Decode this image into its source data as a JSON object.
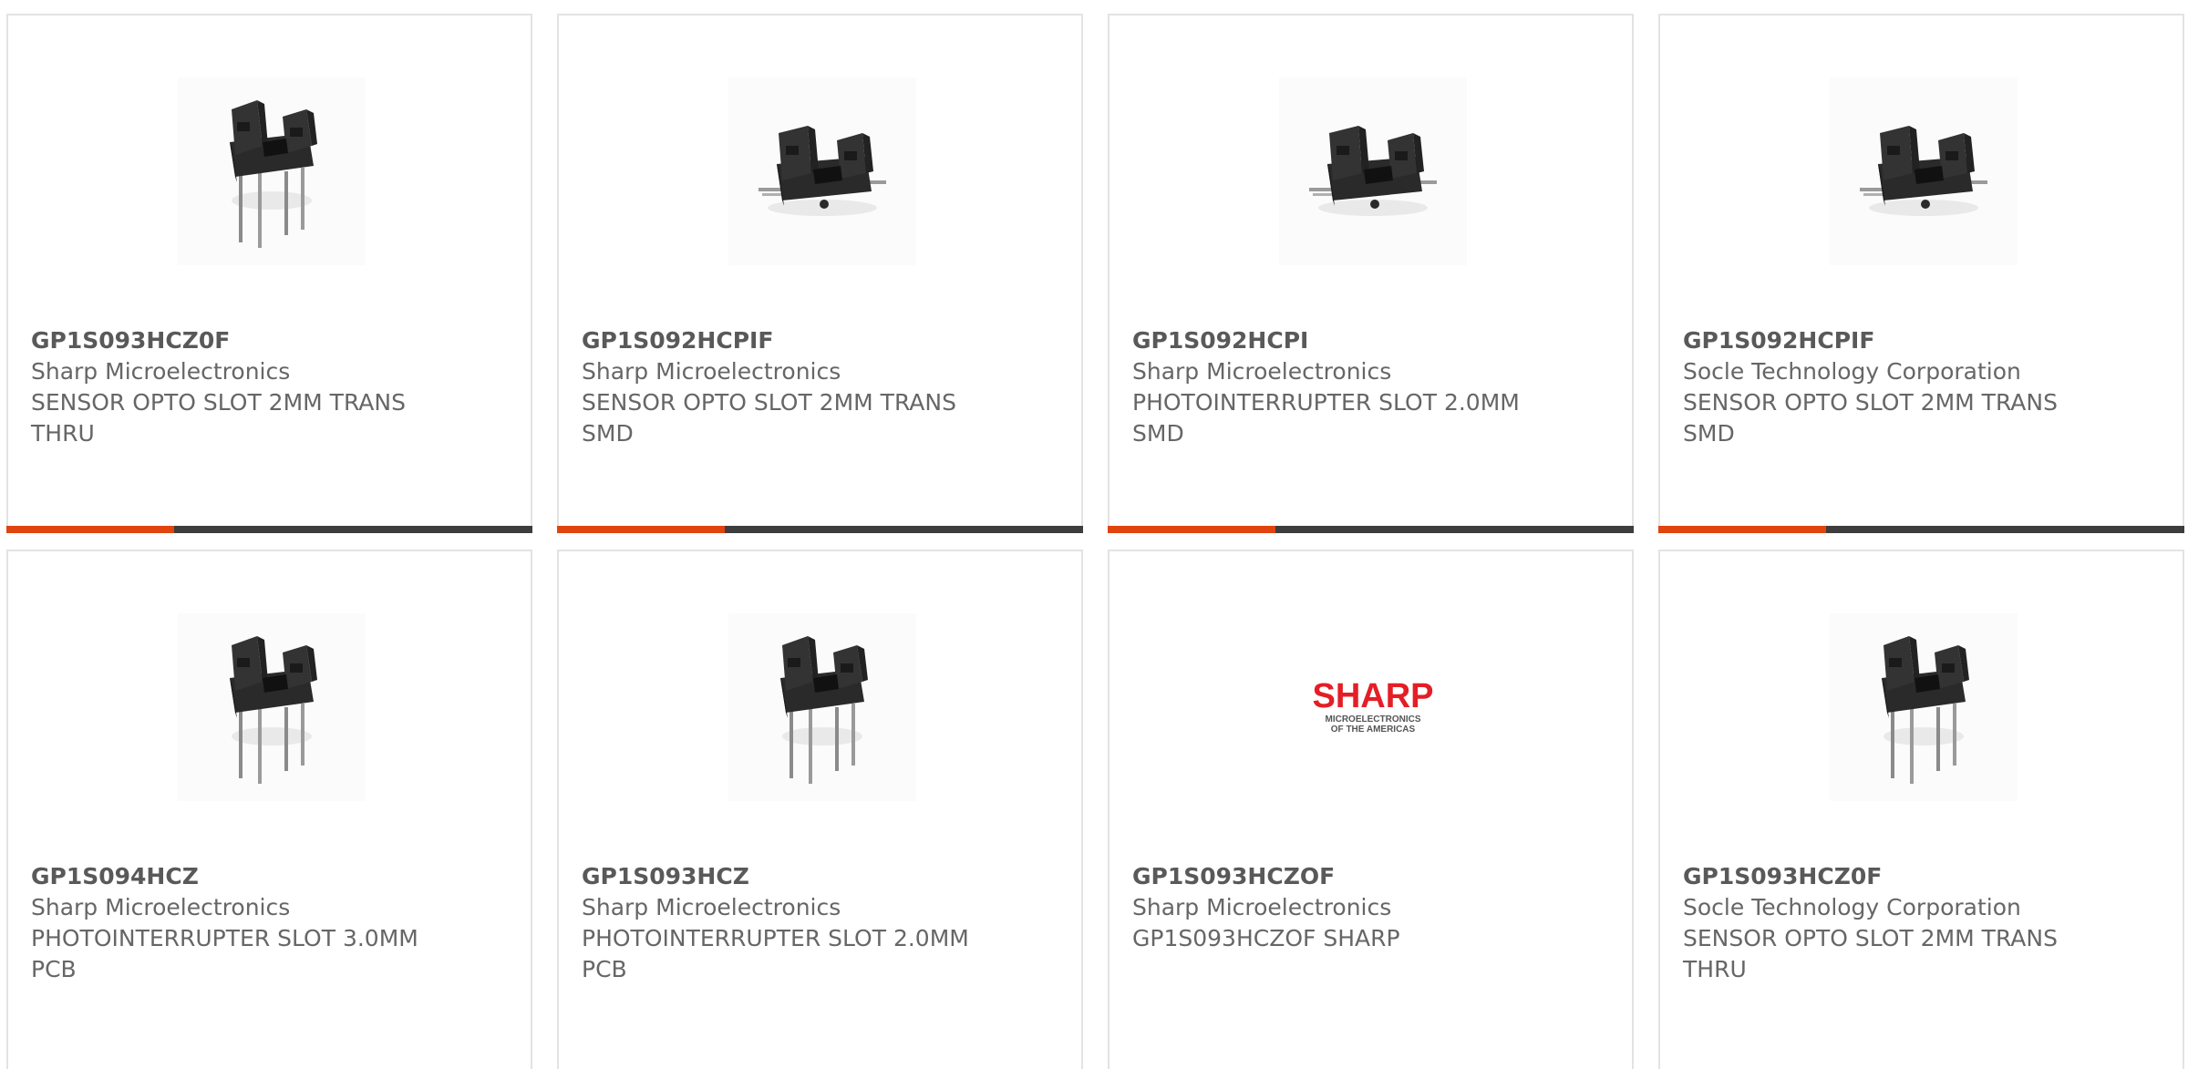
{
  "colors": {
    "accent": "#e0450f",
    "bar": "#3d3d3d",
    "border": "#e3e3e3",
    "text": "#666666",
    "sharp_red": "#e41e26"
  },
  "products": [
    {
      "part_number": "GP1S093HCZ0F",
      "manufacturer": "Sharp Microelectronics",
      "description": "SENSOR OPTO SLOT 2MM TRANS THRU",
      "image": "photointerrupter-thru-hole-icon"
    },
    {
      "part_number": "GP1S092HCPIF",
      "manufacturer": "Sharp Microelectronics",
      "description": "SENSOR OPTO SLOT 2MM TRANS SMD",
      "image": "photointerrupter-smd-icon"
    },
    {
      "part_number": "GP1S092HCPI",
      "manufacturer": "Sharp Microelectronics",
      "description": "PHOTOINTERRUPTER SLOT 2.0MM SMD",
      "image": "photointerrupter-smd-icon"
    },
    {
      "part_number": "GP1S092HCPIF",
      "manufacturer": "Socle Technology Corporation",
      "description": "SENSOR OPTO SLOT 2MM TRANS SMD",
      "image": "photointerrupter-smd-icon"
    },
    {
      "part_number": "GP1S094HCZ",
      "manufacturer": "Sharp Microelectronics",
      "description": "PHOTOINTERRUPTER SLOT 3.0MM PCB",
      "image": "photointerrupter-thru-hole-icon"
    },
    {
      "part_number": "GP1S093HCZ",
      "manufacturer": "Sharp Microelectronics",
      "description": "PHOTOINTERRUPTER SLOT 2.0MM PCB",
      "image": "photointerrupter-thru-hole-icon"
    },
    {
      "part_number": "GP1S093HCZOF",
      "manufacturer": "Sharp Microelectronics",
      "description": "GP1S093HCZOF SHARP",
      "image": "sharp-logo"
    },
    {
      "part_number": "GP1S093HCZ0F",
      "manufacturer": "Socle Technology Corporation",
      "description": "SENSOR OPTO SLOT 2MM TRANS THRU",
      "image": "photointerrupter-thru-hole-icon"
    }
  ],
  "sharp_logo": {
    "brand": "SHARP",
    "tagline_1": "MICROELECTRONICS",
    "tagline_2": "OF THE AMERICAS"
  }
}
